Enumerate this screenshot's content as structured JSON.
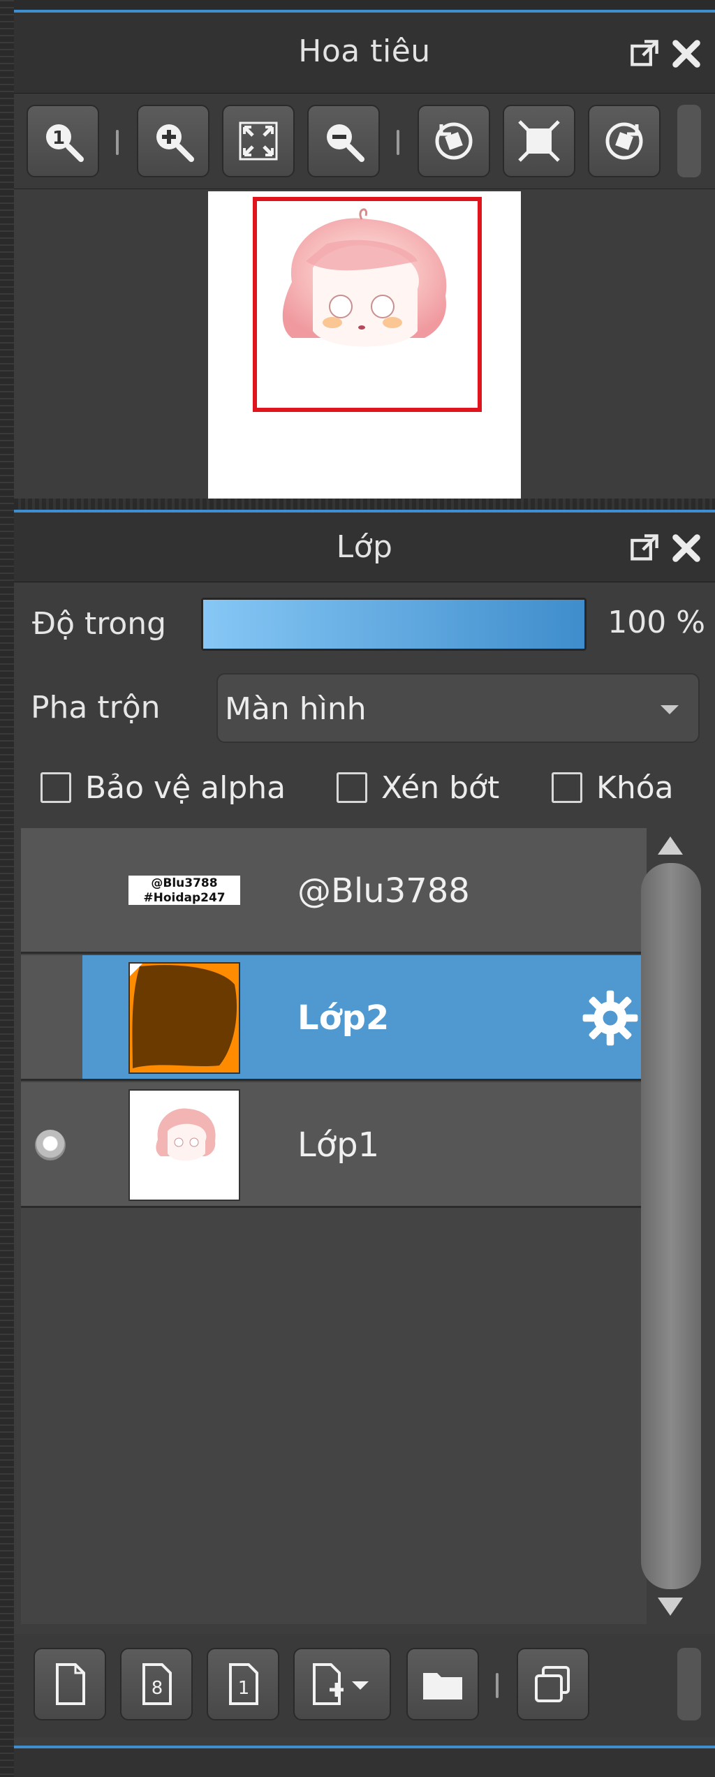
{
  "navigator": {
    "title": "Hoa tiêu",
    "toolbar": [
      {
        "name": "zoom-actual-size-button",
        "icon": "zoom-one-icon"
      },
      {
        "name": "zoom-in-button",
        "icon": "zoom-in-icon"
      },
      {
        "name": "fit-window-button",
        "icon": "fit-window-icon"
      },
      {
        "name": "zoom-out-button",
        "icon": "zoom-out-icon"
      },
      {
        "name": "rotate-left-button",
        "icon": "rotate-left-icon"
      },
      {
        "name": "reset-view-button",
        "icon": "reset-view-icon"
      },
      {
        "name": "rotate-right-button",
        "icon": "rotate-right-icon"
      }
    ]
  },
  "layers": {
    "title": "Lớp",
    "opacity_label": "Độ trong",
    "opacity_value": "100 %",
    "opacity_fraction": 1.0,
    "blend_label": "Pha trộn",
    "blend_value": "Màn hình",
    "checks": {
      "protect_alpha": "Bảo vệ alpha",
      "clipping": "Xén bớt",
      "lock": "Khóa"
    },
    "items": [
      {
        "name": "@Blu3788",
        "thumb_text_1": "@Blu3788",
        "thumb_text_2": "#Hoidap247",
        "selected": false,
        "visible": false
      },
      {
        "name": "Lớp2",
        "selected": true,
        "visible": false
      },
      {
        "name": "Lớp1",
        "selected": false,
        "visible": true
      }
    ]
  },
  "colors": {
    "accent": "#3e8ed0",
    "selection": "#4f98d0",
    "view_rect": "#e0141c",
    "orange": "#ff8c00"
  }
}
